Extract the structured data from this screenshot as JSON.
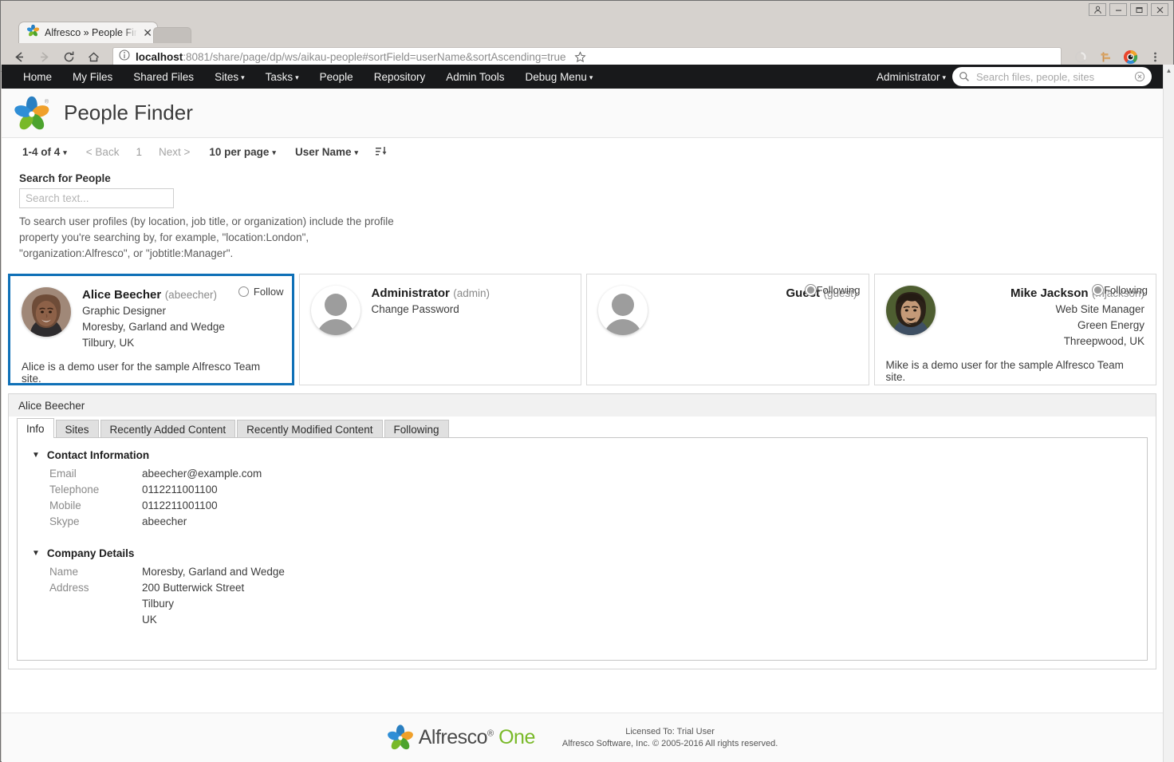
{
  "window": {
    "buttons": [
      "user-icon",
      "minimize",
      "maximize",
      "close"
    ]
  },
  "browser": {
    "tab": {
      "title": "Alfresco » People Finder",
      "favicon": "alfresco-logo-icon",
      "close_label": "✕"
    },
    "toolbar": {
      "back_label": "←",
      "forward_label": "→",
      "reload_label": "⟳",
      "home_label": "⌂",
      "bookmark_label": "☆",
      "icons": [
        "reload-circle-icon",
        "signpost-icon",
        "eye-extension-icon",
        "chrome-menu-icon"
      ]
    },
    "url": {
      "info_label": "ⓘ",
      "host": "localhost",
      "rest": ":8081/share/page/dp/ws/aikau-people#sortField=userName&sortAscending=true"
    }
  },
  "nav": {
    "items": [
      {
        "label": "Home",
        "caret": false
      },
      {
        "label": "My Files",
        "caret": false
      },
      {
        "label": "Shared Files",
        "caret": false
      },
      {
        "label": "Sites",
        "caret": true
      },
      {
        "label": "Tasks",
        "caret": true
      },
      {
        "label": "People",
        "caret": false
      },
      {
        "label": "Repository",
        "caret": false
      },
      {
        "label": "Admin Tools",
        "caret": false
      },
      {
        "label": "Debug Menu",
        "caret": true
      }
    ],
    "caret": "▾",
    "user_menu": "Administrator",
    "search_placeholder": "Search files, people, sites",
    "search_value": "",
    "clear_label": "⊗"
  },
  "header": {
    "title": "People Finder",
    "logo": "alfresco-flower-logo"
  },
  "paging": {
    "range": "1-4 of 4",
    "caret": "▾",
    "back": "< Back",
    "page": "1",
    "next": "Next >",
    "per_page": "10 per page",
    "sort_field": "User Name",
    "sort_direction_icon": "sort-ascending-icon"
  },
  "search": {
    "label": "Search for People",
    "placeholder": "Search text...",
    "value": "",
    "hint": "To search user profiles (by location, job title, or organization) include the profile property you're searching by, for example, \"location:London\", \"organization:Alfresco\", or \"jobtitle:Manager\"."
  },
  "people": [
    {
      "name": "Alice Beecher",
      "username": "(abeecher)",
      "job_title": "Graphic Designer",
      "organization": "Moresby, Garland and Wedge",
      "location": "Tilbury, UK",
      "description": "Alice is a demo user for the sample Alfresco Team site.",
      "follow_label": "Follow",
      "following": false,
      "avatar": "photo-female",
      "selected": true,
      "link": ""
    },
    {
      "name": "Administrator",
      "username": "(admin)",
      "job_title": "",
      "organization": "",
      "location": "",
      "description": "",
      "follow_label": "",
      "following": false,
      "avatar": "generic",
      "selected": false,
      "link": "Change Password"
    },
    {
      "name": "Guest",
      "username": "(guest)",
      "job_title": "",
      "organization": "",
      "location": "",
      "description": "",
      "follow_label": "Following",
      "following": true,
      "avatar": "generic",
      "selected": false,
      "link": ""
    },
    {
      "name": "Mike Jackson",
      "username": "(mjackson)",
      "job_title": "Web Site Manager",
      "organization": "Green Energy",
      "location": "Threepwood, UK",
      "description": "Mike is a demo user for the sample Alfresco Team site.",
      "follow_label": "Following",
      "following": true,
      "avatar": "photo-male",
      "selected": false,
      "link": ""
    }
  ],
  "detail": {
    "title": "Alice Beecher",
    "tabs": [
      {
        "label": "Info",
        "active": true
      },
      {
        "label": "Sites",
        "active": false
      },
      {
        "label": "Recently Added Content",
        "active": false
      },
      {
        "label": "Recently Modified Content",
        "active": false
      },
      {
        "label": "Following",
        "active": false
      }
    ],
    "twisty": "▼",
    "sections": [
      {
        "heading": "Contact Information",
        "rows": [
          {
            "label": "Email",
            "value": "abeecher@example.com"
          },
          {
            "label": "Telephone",
            "value": "0112211001100"
          },
          {
            "label": "Mobile",
            "value": "0112211001100"
          },
          {
            "label": "Skype",
            "value": "abeecher"
          }
        ]
      },
      {
        "heading": "Company Details",
        "rows": [
          {
            "label": "Name",
            "value": "Moresby, Garland and Wedge"
          },
          {
            "label": "Address",
            "value": "200 Butterwick Street"
          },
          {
            "label": "",
            "value": "Tilbury"
          },
          {
            "label": "",
            "value": "UK"
          }
        ]
      }
    ]
  },
  "footer": {
    "brand": "Alfresco",
    "brand_suffix": "One",
    "license": "Licensed To: Trial User",
    "copyright": "Alfresco Software, Inc. © 2005-2016 All rights reserved."
  },
  "colors": {
    "accent": "#0f70b7",
    "navbar": "#18191b",
    "brand_green": "#79b928"
  }
}
